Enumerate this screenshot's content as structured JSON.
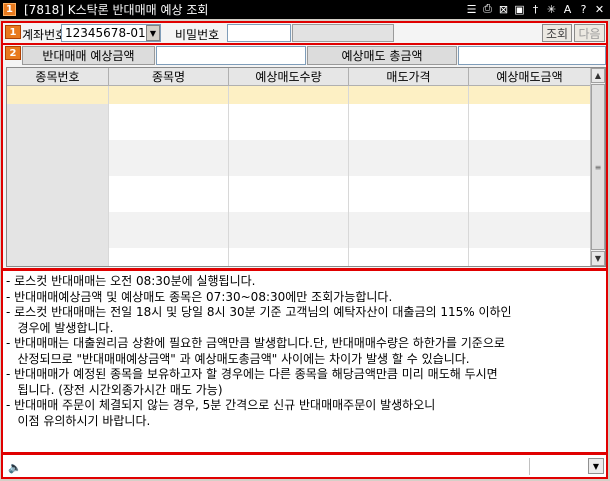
{
  "window": {
    "number": "1",
    "title": "[7818] K스탁론 반대매매 예상 조회",
    "icons": [
      "mouse-icon",
      "print-icon",
      "close-box-icon",
      "restore-icon",
      "pin-icon",
      "settings-icon",
      "font-icon",
      "help-icon",
      "close-icon"
    ]
  },
  "form": {
    "badge": "1",
    "account_label": "계좌번호",
    "account_value": "12345678-01",
    "password_label": "비밀번호",
    "password_value": "",
    "query_button": "조회",
    "next_button": "다음"
  },
  "summary": {
    "badge": "2",
    "expected_amount_label": "반대매매 예상금액",
    "expected_amount_value": "",
    "expected_total_label": "예상매도 총금액",
    "expected_total_value": ""
  },
  "grid": {
    "columns": [
      "종목번호",
      "종목명",
      "예상매도수량",
      "매도가격",
      "예상매도금액"
    ],
    "rows": []
  },
  "notes": [
    "- 로스컷 반대매매는 오전 08:30분에 실행됩니다.",
    "- 반대매매예상금액 및 예상매도 종목은 07:30~08:30에만 조회가능합니다.",
    "- 로스컷 반대매매는 전일 18시 및 당일 8시 30분 기준 고객님의 예탁자산이 대출금의 115% 이하인",
    "   경우에 발생합니다.",
    "- 반대매매는 대출원리금 상환에 필요한 금액만큼 발생합니다.단, 반대매매수량은 하한가를 기준으로",
    "   산정되므로 \"반대매매예상금액\" 과 예상매도총금액\" 사이에는 차이가 발생 할 수 있습니다.",
    "- 반대매매가 예정된 종목을 보유하고자 할 경우에는 다른 종목을 해당금액만큼 미리 매도해 두시면",
    "   됩니다. (장전 시간외종가시간 매도 가능)",
    "- 반대매매 주문이 체결되지 않는 경우, 5분 간격으로 신규 반대매매주문이 발생하오니",
    "   이점 유의하시기 바랍니다."
  ],
  "status": {
    "message": ""
  }
}
